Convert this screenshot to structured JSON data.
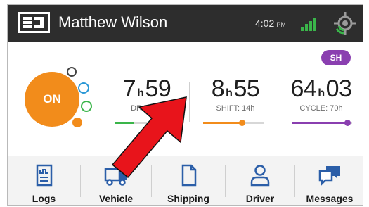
{
  "header": {
    "user_name": "Matthew Wilson",
    "time": "4:02",
    "time_suffix": "PM",
    "logo_icon": "eld-logo-icon",
    "signal_icon": "cell-signal-icon",
    "gps_icon": "gps-location-icon"
  },
  "badge": {
    "label": "SH"
  },
  "status": {
    "label": "ON"
  },
  "timers": [
    {
      "hours": "7",
      "h_unit": "h",
      "minutes": "59",
      "caption": "DRIVE: 1",
      "progress": 0.3,
      "color": "#3ab54a"
    },
    {
      "hours": "8",
      "h_unit": "h",
      "minutes": "55",
      "caption": "SHIFT: 14h",
      "progress": 0.64,
      "color": "#f28c1b"
    },
    {
      "hours": "64",
      "h_unit": "h",
      "minutes": "03",
      "caption": "CYCLE: 70h",
      "progress": 0.92,
      "color": "#8a3fb0"
    }
  ],
  "nav": [
    {
      "label": "Logs",
      "icon": "logs-icon"
    },
    {
      "label": "Vehicle",
      "icon": "truck-icon"
    },
    {
      "label": "Shipping",
      "icon": "document-icon"
    },
    {
      "label": "Driver",
      "icon": "person-icon"
    },
    {
      "label": "Messages",
      "icon": "message-bubbles-icon"
    }
  ],
  "colors": {
    "header_bg": "#2d2d2d",
    "on_duty": "#f28c1b",
    "drive": "#3ab54a",
    "sleeper": "#2b98d6",
    "badge": "#8a3fb0",
    "icon_blue": "#2b5ea8",
    "arrow_red": "#e8141b"
  }
}
